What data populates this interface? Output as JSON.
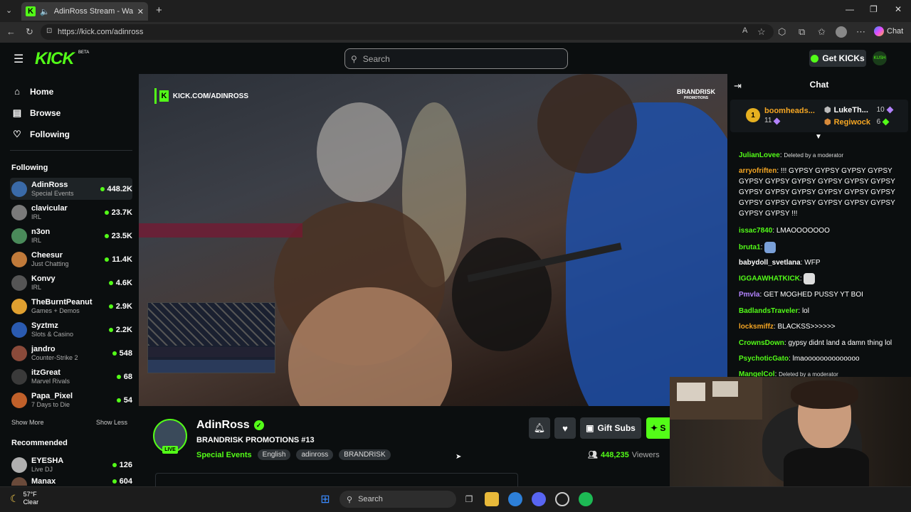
{
  "browser": {
    "tab_title": "AdinRoss Stream - Watch Live",
    "url": "https://kick.com/adinross",
    "copilot_label": "Chat"
  },
  "header": {
    "logo": "KICK",
    "beta": "BETA",
    "search_placeholder": "Search",
    "get_kicks": "Get KICKs",
    "avatar_text": "KUSH"
  },
  "sidebar": {
    "nav": [
      {
        "label": "Home",
        "icon": "home-icon"
      },
      {
        "label": "Browse",
        "icon": "browse-icon"
      },
      {
        "label": "Following",
        "icon": "heart-icon"
      }
    ],
    "following_title": "Following",
    "following": [
      {
        "name": "AdinRoss",
        "category": "Special Events",
        "viewers": "448.2K"
      },
      {
        "name": "clavicular",
        "category": "IRL",
        "viewers": "23.7K"
      },
      {
        "name": "n3on",
        "category": "IRL",
        "viewers": "23.5K"
      },
      {
        "name": "Cheesur",
        "category": "Just Chatting",
        "viewers": "11.4K"
      },
      {
        "name": "Konvy",
        "category": "IRL",
        "viewers": "4.6K"
      },
      {
        "name": "TheBurntPeanut",
        "category": "Games + Demos",
        "viewers": "2.9K"
      },
      {
        "name": "Syztmz",
        "category": "Slots & Casino",
        "viewers": "2.2K"
      },
      {
        "name": "jandro",
        "category": "Counter-Strike 2",
        "viewers": "548"
      },
      {
        "name": "itzGreat",
        "category": "Marvel Rivals",
        "viewers": "68"
      },
      {
        "name": "Papa_Pixel",
        "category": "7 Days to Die",
        "viewers": "54"
      }
    ],
    "show_more": "Show More",
    "show_less": "Show Less",
    "recommended_title": "Recommended",
    "recommended": [
      {
        "name": "EYESHA",
        "category": "Live DJ",
        "viewers": "126"
      },
      {
        "name": "Manax",
        "category": "",
        "viewers": "604"
      }
    ]
  },
  "video": {
    "watermark": "KICK.COM/ADINROSS",
    "brand_logo": "BRANDRISK",
    "brand_sub": "PROMOTIONS"
  },
  "stream": {
    "channel": "AdinRoss",
    "live": "LIVE",
    "title": "BRANDRISK PROMOTIONS #13",
    "category": "Special Events",
    "tags": [
      "English",
      "adinross",
      "BRANDRISK"
    ],
    "gift_subs": "Gift Subs",
    "subscribe_partial": "S",
    "viewers": "448,235",
    "viewers_label": "Viewers"
  },
  "chat": {
    "title": "Chat",
    "leaderboard": [
      {
        "rank": "1",
        "name": "boomheads...",
        "count": "11"
      },
      {
        "name": "LukeTh...",
        "count": "10"
      },
      {
        "name": "Regiwock",
        "count": "6"
      }
    ],
    "messages": [
      {
        "user": "JulianLovee",
        "color": "#53fc18",
        "text": "Deleted by a moderator",
        "deleted": true
      },
      {
        "user": "arryofriften",
        "color": "#f5a623",
        "text": "!!! GYPSY GYPSY GYPSY GYPSY GYPSY GYPSY GYPSY GYPSY GYPSY GYPSY GYPSY GYPSY GYPSY GYPSY GYPSY GYPSY GYPSY GYPSY GYPSY GYPSY GYPSY GYPSY GYPSY GYPSY !!!"
      },
      {
        "user": "issac7840",
        "color": "#53fc18",
        "text": "LMAOOOOOOO"
      },
      {
        "user": "bruta1",
        "color": "#53fc18",
        "text": "",
        "emote": true
      },
      {
        "user": "babydoll_svetlana",
        "color": "#ffffff",
        "text": "WFP"
      },
      {
        "user": "IGGAAWHATKICK",
        "color": "#53fc18",
        "text": "",
        "emote": true
      },
      {
        "user": "Pmvla",
        "color": "#b383ff",
        "text": "GET MOGHED PUSSY YT BOI"
      },
      {
        "user": "BadlandsTraveler",
        "color": "#53fc18",
        "text": "lol"
      },
      {
        "user": "locksmiffz",
        "color": "#f5a623",
        "text": "BLACKSS>>>>>>"
      },
      {
        "user": "CrownsDown",
        "color": "#53fc18",
        "text": "gypsy didnt land a damn thing lol"
      },
      {
        "user": "PsychoticGato",
        "color": "#53fc18",
        "text": "lmaoooooooooooooo"
      },
      {
        "user": "MangelCol",
        "color": "#53fc18",
        "text": "Deleted by a moderator",
        "deleted": true
      }
    ]
  },
  "taskbar": {
    "temp": "57°F",
    "weather": "Clear",
    "search": "Search"
  },
  "colors": {
    "kick_green": "#53fc18",
    "background": "#0b0e0f",
    "panel": "#2f3438"
  }
}
